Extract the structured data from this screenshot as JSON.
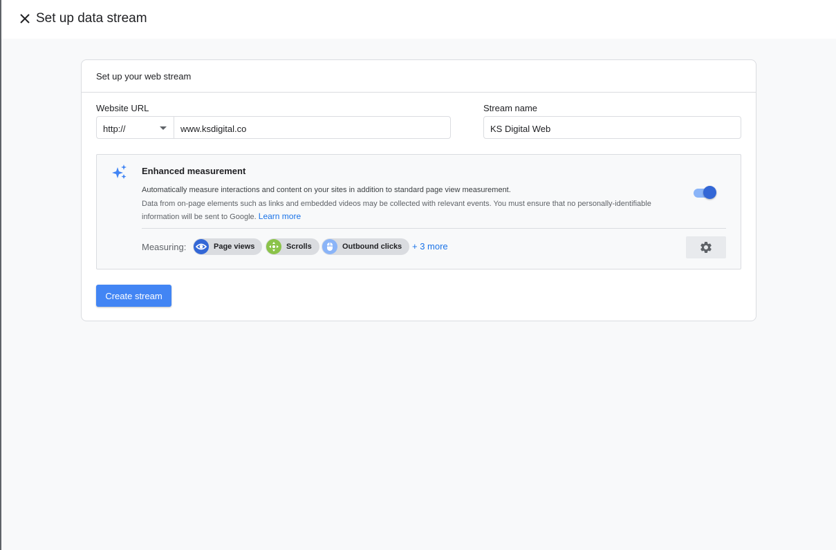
{
  "header": {
    "title": "Set up data stream"
  },
  "card": {
    "title": "Set up your web stream",
    "website_url": {
      "label": "Website URL",
      "protocol": "http://",
      "value": "www.ksdigital.co"
    },
    "stream_name": {
      "label": "Stream name",
      "value": "KS Digital Web"
    },
    "enhanced_measurement": {
      "title": "Enhanced measurement",
      "description_line1": "Automatically measure interactions and content on your sites in addition to standard page view measurement.",
      "description_line2": "Data from on-page elements such as links and embedded videos may be collected with relevant events. You must ensure that no personally-identifiable information will be sent to Google.",
      "learn_more": "Learn more",
      "enabled": true,
      "measuring_label": "Measuring:",
      "chips": [
        {
          "label": "Page views",
          "icon": "eye-icon",
          "color": "#3367d6"
        },
        {
          "label": "Scrolls",
          "icon": "scroll-icon",
          "color": "#8bc34a"
        },
        {
          "label": "Outbound clicks",
          "icon": "mouse-icon",
          "color": "#8ab4f8"
        }
      ],
      "more": "+ 3 more"
    },
    "create_button": "Create stream"
  },
  "colors": {
    "accent": "#1a73e8",
    "primary_button": "#4285f4",
    "border": "#dadce0"
  }
}
